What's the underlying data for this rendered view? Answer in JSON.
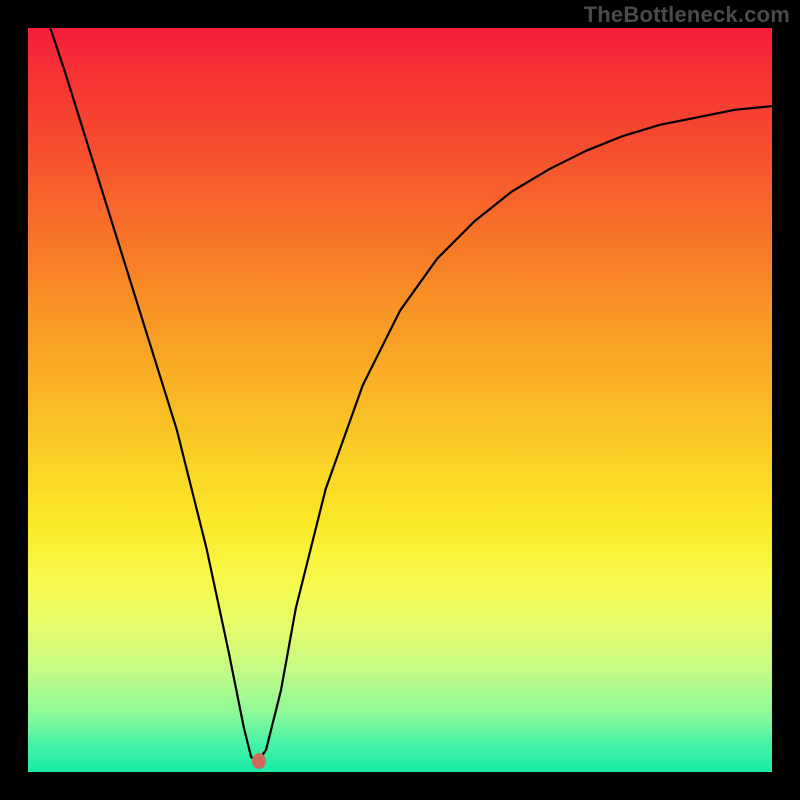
{
  "watermark": "TheBottleneck.com",
  "chart_data": {
    "type": "line",
    "title": "",
    "xlabel": "",
    "ylabel": "",
    "xlim": [
      0,
      100
    ],
    "ylim": [
      0,
      100
    ],
    "series": [
      {
        "name": "bottleneck-curve",
        "x": [
          2,
          5,
          10,
          15,
          20,
          24,
          27,
          29,
          30,
          31,
          32,
          34,
          36,
          40,
          45,
          50,
          55,
          60,
          65,
          70,
          75,
          80,
          85,
          90,
          95,
          100
        ],
        "values": [
          103,
          94,
          78,
          62,
          46,
          30,
          16,
          6,
          2,
          1.5,
          3,
          11,
          22,
          38,
          52,
          62,
          69,
          74,
          78,
          81,
          83.5,
          85.5,
          87,
          88,
          89,
          89.5
        ]
      }
    ],
    "marker": {
      "x": 31,
      "y": 1.5
    },
    "background_gradient": {
      "orientation": "vertical",
      "stops": [
        {
          "pos": 0,
          "color": "#f61d3b"
        },
        {
          "pos": 50,
          "color": "#f9c826"
        },
        {
          "pos": 100,
          "color": "#17eaa6"
        }
      ]
    }
  }
}
